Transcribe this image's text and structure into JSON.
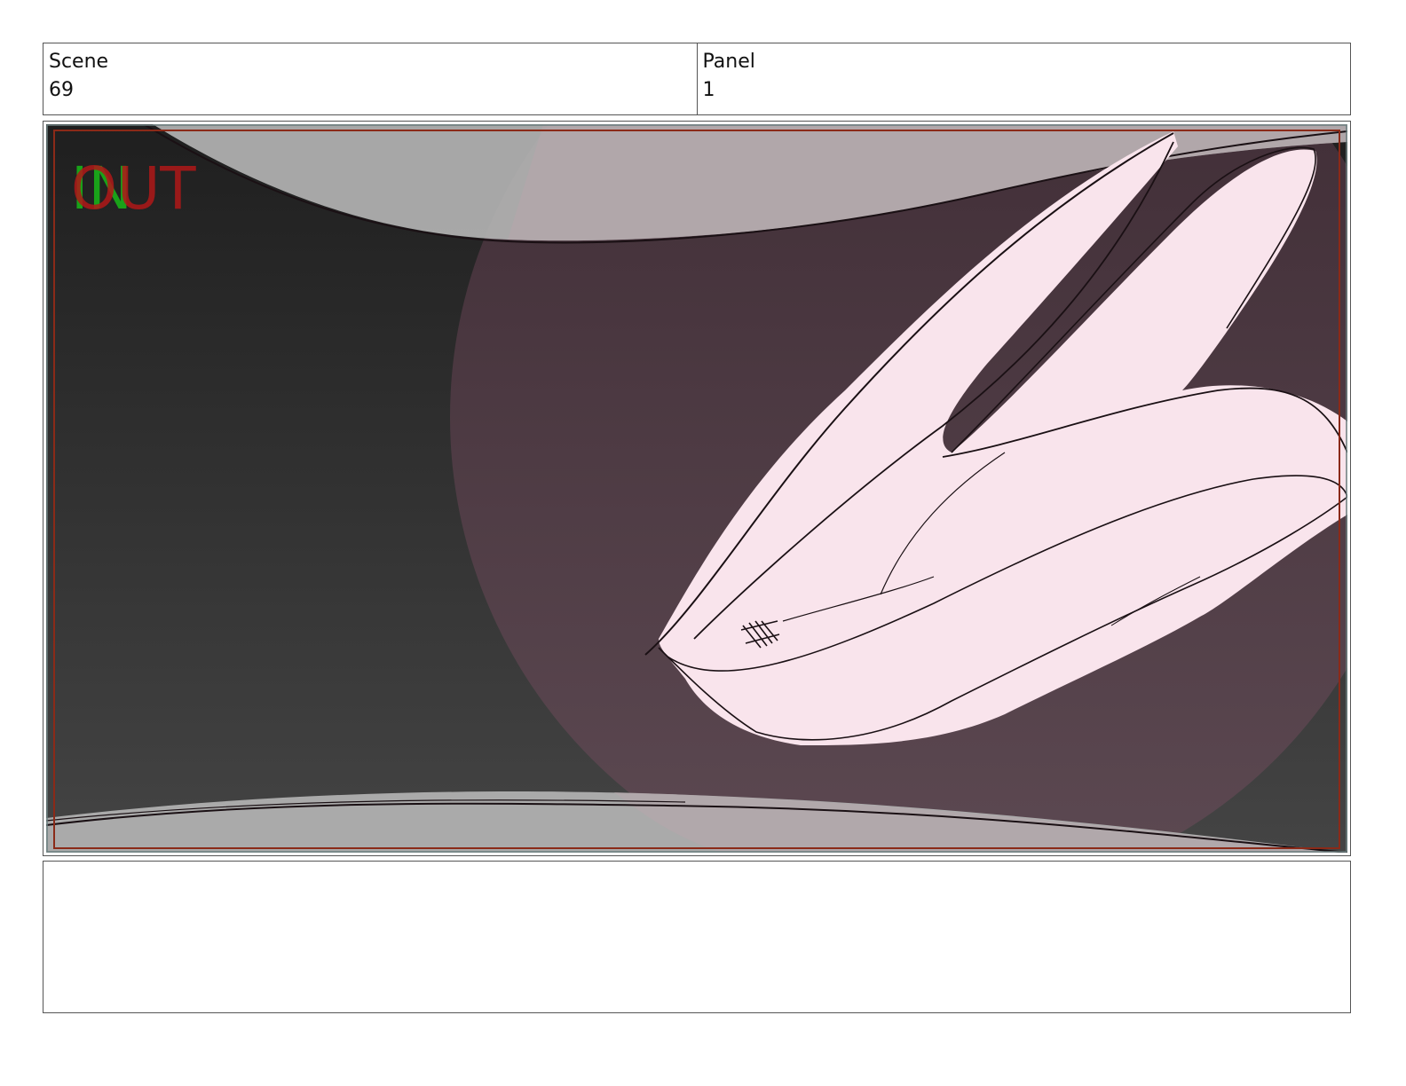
{
  "header": {
    "scene_label": "Scene",
    "scene_value": "69",
    "panel_label": "Panel",
    "panel_value": "1"
  },
  "panel": {
    "in_marker": "IN",
    "out_marker": "OUT",
    "colors": {
      "background_dark": "#222222",
      "background_mid": "#3c3c3c",
      "vignette_light": "#b3b3b3",
      "spotlight": "#5a4650",
      "ears_fill": "#f9e4ec",
      "line": "#1a1014",
      "in_marker": "#19b019",
      "out_marker": "#b01818",
      "safe_frame": "#8b2a18"
    }
  },
  "notes": {
    "text": ""
  }
}
